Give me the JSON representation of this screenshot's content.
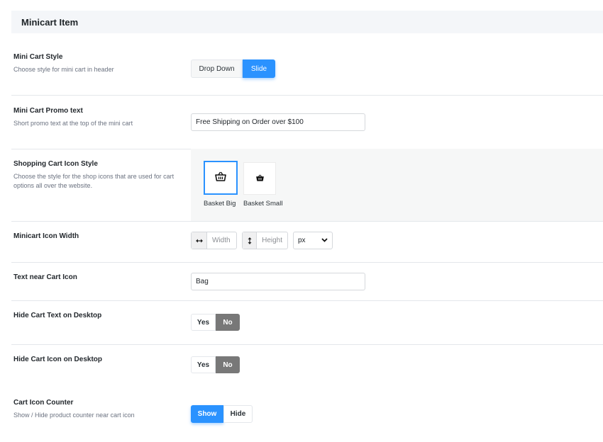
{
  "section_title": "Minicart Item",
  "mini_cart_style": {
    "title": "Mini Cart Style",
    "desc": "Choose style for mini cart in header",
    "options": [
      "Drop Down",
      "Slide"
    ],
    "selected": "Slide"
  },
  "promo_text": {
    "title": "Mini Cart Promo text",
    "desc": "Short promo text at the top of the mini cart",
    "value": "Free Shipping on Order over $100"
  },
  "icon_style": {
    "title": "Shopping Cart Icon Style",
    "desc": "Choose the style for the shop icons that are used for cart options all over the website.",
    "options": [
      {
        "label": "Basket Big",
        "icon": "basket-big-icon"
      },
      {
        "label": "Basket Small",
        "icon": "basket-small-icon"
      }
    ],
    "selected": "Basket Big"
  },
  "icon_width": {
    "title": "Minicart Icon Width",
    "width_placeholder": "Width",
    "height_placeholder": "Height",
    "unit": "px"
  },
  "text_near_icon": {
    "title": "Text near Cart Icon",
    "value": "Bag"
  },
  "hide_cart_text": {
    "title": "Hide Cart Text on Desktop",
    "yes": "Yes",
    "no": "No",
    "selected": "No"
  },
  "hide_cart_icon": {
    "title": "Hide Cart Icon on Desktop",
    "yes": "Yes",
    "no": "No",
    "selected": "No"
  },
  "icon_counter": {
    "title": "Cart Icon Counter",
    "desc": "Show / Hide product counter near cart icon",
    "show": "Show",
    "hide": "Hide",
    "selected": "Show"
  },
  "colors": {
    "accent": "#2a92ff",
    "active_gray": "#787878",
    "header_bg": "#f4f6f9"
  }
}
